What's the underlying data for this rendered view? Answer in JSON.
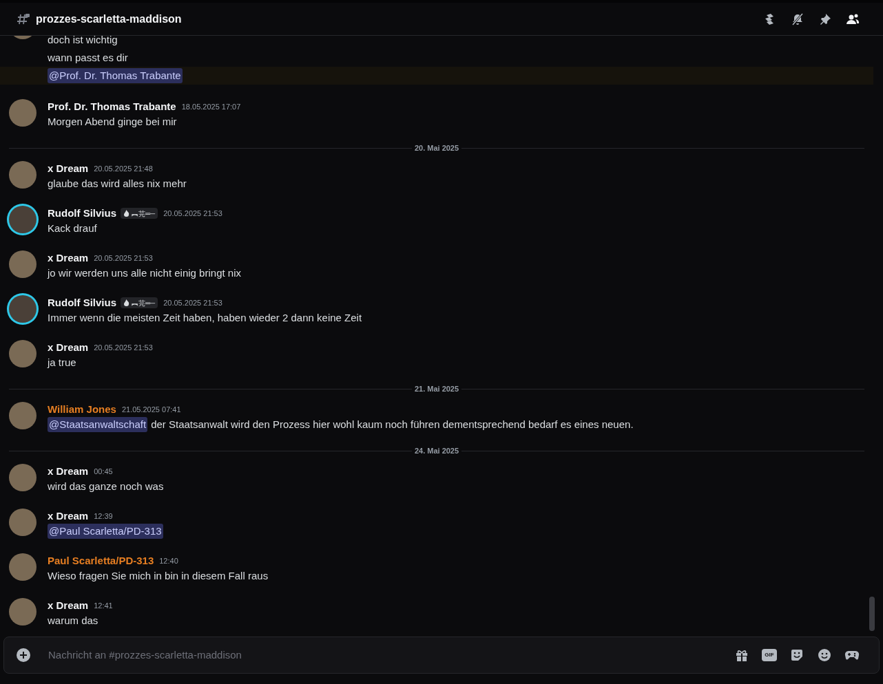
{
  "header": {
    "channel_name": "prozzes-scarletta-maddison"
  },
  "messages": [
    {
      "kind": "cut_group",
      "lines": [
        {
          "highlighted": false,
          "parts": [
            {
              "mention": false,
              "text": "doch ist wichtig"
            }
          ]
        },
        {
          "highlighted": false,
          "parts": [
            {
              "mention": false,
              "text": "wann passt es dir"
            }
          ]
        },
        {
          "highlighted": true,
          "parts": [
            {
              "mention": true,
              "text": "@Prof. Dr. Thomas Trabante"
            }
          ]
        }
      ]
    },
    {
      "kind": "group",
      "author": "Prof. Dr. Thomas Trabante",
      "color": "#f2f3f5",
      "time": "18.05.2025 17:07",
      "lines": [
        {
          "highlighted": false,
          "parts": [
            {
              "mention": false,
              "text": "Morgen Abend ginge bei mir"
            }
          ]
        }
      ]
    },
    {
      "kind": "divider",
      "text": "20. Mai 2025"
    },
    {
      "kind": "group",
      "author": "x Dream",
      "color": "#f2f3f5",
      "time": "20.05.2025 21:48",
      "lines": [
        {
          "highlighted": false,
          "parts": [
            {
              "mention": false,
              "text": "glaube das wird alles nix mehr"
            }
          ]
        }
      ]
    },
    {
      "kind": "group",
      "author": "Rudolf Silvius",
      "color": "#f2f3f5",
      "decorated": true,
      "tag": "︻芫═─",
      "time": "20.05.2025 21:53",
      "lines": [
        {
          "highlighted": false,
          "parts": [
            {
              "mention": false,
              "text": "Kack drauf"
            }
          ]
        }
      ]
    },
    {
      "kind": "group",
      "author": "x Dream",
      "color": "#f2f3f5",
      "time": "20.05.2025 21:53",
      "lines": [
        {
          "highlighted": false,
          "parts": [
            {
              "mention": false,
              "text": "jo wir werden uns alle nicht einig bringt nix"
            }
          ]
        }
      ]
    },
    {
      "kind": "group",
      "author": "Rudolf Silvius",
      "color": "#f2f3f5",
      "decorated": true,
      "tag": "︻芫═─",
      "time": "20.05.2025 21:53",
      "lines": [
        {
          "highlighted": false,
          "parts": [
            {
              "mention": false,
              "text": "Immer wenn die meisten Zeit haben, haben wieder 2 dann keine Zeit"
            }
          ]
        }
      ]
    },
    {
      "kind": "group",
      "author": "x Dream",
      "color": "#f2f3f5",
      "time": "20.05.2025 21:53",
      "lines": [
        {
          "highlighted": false,
          "parts": [
            {
              "mention": false,
              "text": "ja true"
            }
          ]
        }
      ]
    },
    {
      "kind": "divider",
      "text": "21. Mai 2025"
    },
    {
      "kind": "group",
      "author": "William Jones",
      "color": "#e67e22",
      "time": "21.05.2025 07:41",
      "lines": [
        {
          "highlighted": false,
          "parts": [
            {
              "mention": true,
              "text": "@Staatsanwaltschaft"
            },
            {
              "mention": false,
              "text": "der Staatsanwalt wird den Prozess hier wohl kaum noch führen dementsprechend bedarf es eines neuen."
            }
          ]
        }
      ]
    },
    {
      "kind": "divider",
      "text": "24. Mai 2025"
    },
    {
      "kind": "group",
      "author": "x Dream",
      "color": "#f2f3f5",
      "time": "00:45",
      "lines": [
        {
          "highlighted": false,
          "parts": [
            {
              "mention": false,
              "text": "wird das ganze noch was"
            }
          ]
        }
      ]
    },
    {
      "kind": "group",
      "author": "x Dream",
      "color": "#f2f3f5",
      "time": "12:39",
      "lines": [
        {
          "highlighted": false,
          "parts": [
            {
              "mention": true,
              "text": "@Paul Scarletta/PD-313"
            }
          ]
        }
      ]
    },
    {
      "kind": "group",
      "author": "Paul Scarletta/PD-313",
      "color": "#e67e22",
      "time": "12:40",
      "lines": [
        {
          "highlighted": false,
          "parts": [
            {
              "mention": false,
              "text": "Wieso fragen Sie mich in bin in diesem Fall raus"
            }
          ]
        }
      ]
    },
    {
      "kind": "group",
      "author": "x Dream",
      "color": "#f2f3f5",
      "time": "12:41",
      "lines": [
        {
          "highlighted": false,
          "parts": [
            {
              "mention": false,
              "text": "warum das"
            }
          ]
        }
      ]
    }
  ],
  "composer": {
    "placeholder": "Nachricht an #prozzes-scarletta-maddison",
    "gif_label": "GIF"
  }
}
